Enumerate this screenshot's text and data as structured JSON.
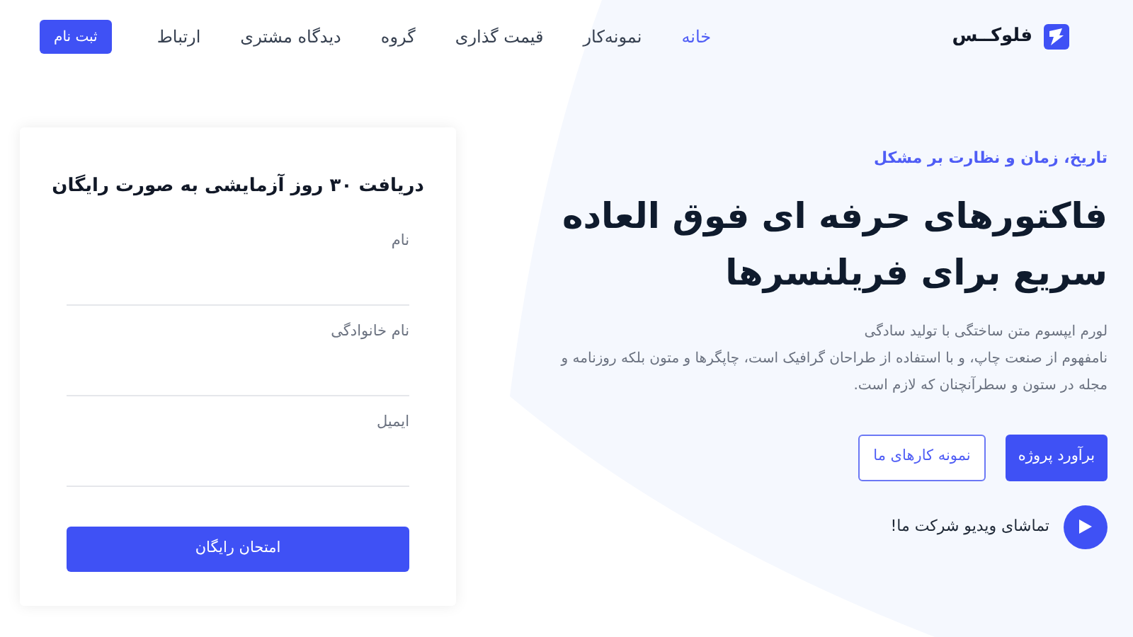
{
  "brand": {
    "name": "فلوکــس"
  },
  "nav": {
    "links": [
      {
        "label": "خانه",
        "selected": true
      },
      {
        "label": "نمونه‌کار",
        "selected": false
      },
      {
        "label": "قیمت گذاری",
        "selected": false
      },
      {
        "label": "گروه",
        "selected": false
      },
      {
        "label": "دیدگاه مشتری",
        "selected": false
      },
      {
        "label": "ارتباط",
        "selected": false
      }
    ],
    "signup": "ثبت نام"
  },
  "hero": {
    "eyebrow": "تاریخ، زمان و نظارت بر مشکل",
    "title_lines": [
      "فاکتورهای حرفه ای فوق العاده",
      "سریع برای فریلنسرها"
    ],
    "description_lines": [
      "لورم ایپسوم متن ساختگی با تولید سادگی",
      "نامفهوم از صنعت چاپ، و با استفاده از طراحان گرافیک است، چاپگرها و متون بلکه روزنامه و",
      "مجله در ستون و سطرآنچنان که لازم است."
    ],
    "buttons": [
      {
        "label": "برآورد پروژه",
        "kind": "primary"
      },
      {
        "label": "نمونه کارهای ما",
        "kind": "outline"
      }
    ],
    "video": "تماشای ویدیو شرکت ما!"
  },
  "form": {
    "title": "دریافت ۳۰ روز آزمایشی به صورت رایگان",
    "fields": [
      {
        "label": "نام"
      },
      {
        "label": "نام خانوادگی"
      },
      {
        "label": "ایمیل"
      }
    ],
    "submit": "امتحان رایگان"
  }
}
